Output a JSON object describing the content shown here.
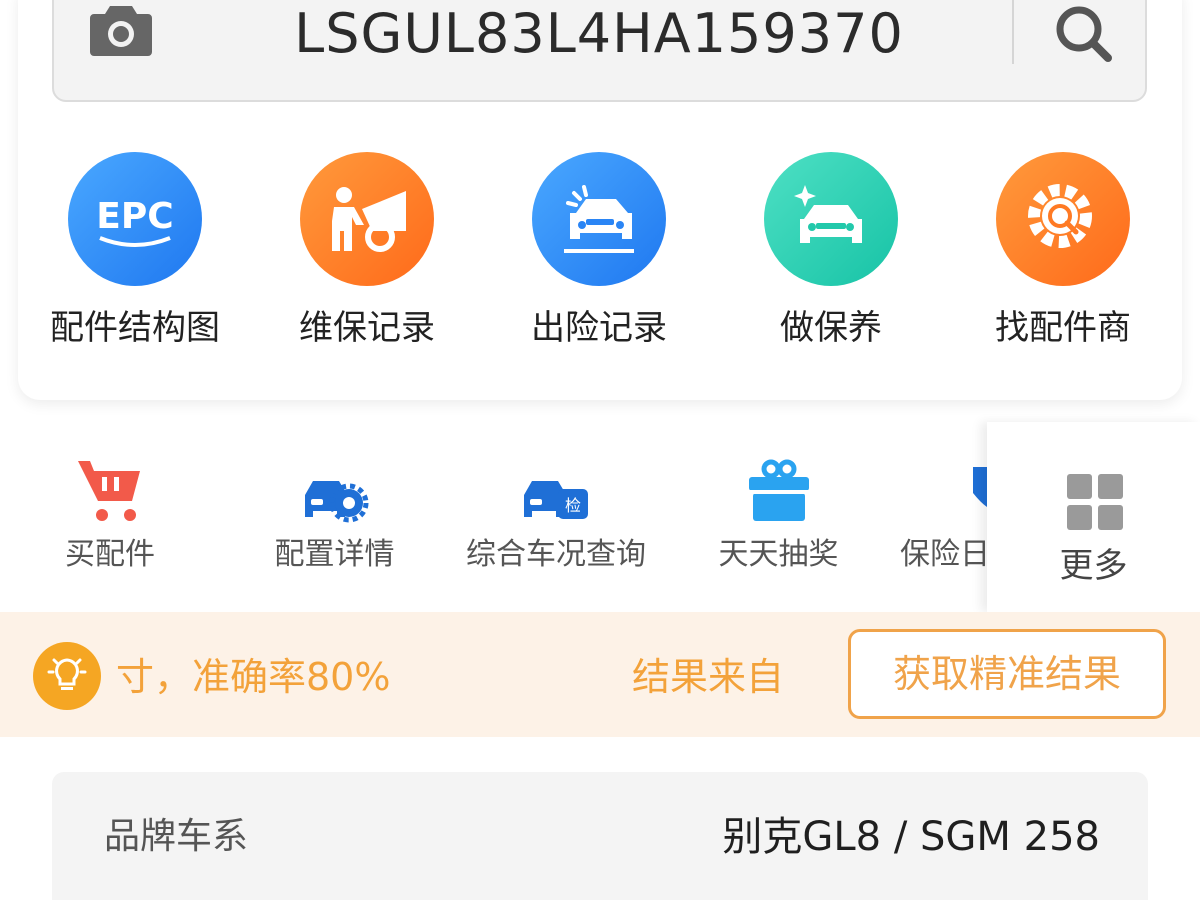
{
  "search": {
    "vin": "LSGUL83L4HA159370"
  },
  "features": [
    {
      "label": "配件结构图",
      "icon": "epc-icon",
      "badge": "EPC",
      "color_from": "#4aa8ff",
      "color_to": "#1f78f0"
    },
    {
      "label": "维保记录",
      "icon": "mechanic-icon",
      "color_from": "#ff9a3c",
      "color_to": "#ff6a1a"
    },
    {
      "label": "出险记录",
      "icon": "accident-car-icon",
      "color_from": "#4aa8ff",
      "color_to": "#1f78f0"
    },
    {
      "label": "做保养",
      "icon": "clean-car-icon",
      "color_from": "#4ee0c4",
      "color_to": "#17c3a6"
    },
    {
      "label": "找配件商",
      "icon": "gear-search-icon",
      "color_from": "#ff9a3c",
      "color_to": "#ff6a1a"
    }
  ],
  "secondary": [
    {
      "label": "买配件",
      "icon": "cart-icon"
    },
    {
      "label": "配置详情",
      "icon": "car-gear-icon"
    },
    {
      "label": "综合车况查询",
      "icon": "car-check-icon",
      "badge": "检"
    },
    {
      "label": "天天抽奖",
      "icon": "gift-icon"
    },
    {
      "label": "保险日",
      "icon": "shield-icon"
    }
  ],
  "more": {
    "label": "更多"
  },
  "notice": {
    "text_left": "寸，准确率80%",
    "text_right": "结果来自",
    "button": "获取精准结果"
  },
  "info": {
    "label": "品牌车系",
    "value": "别克GL8 / SGM 258"
  },
  "colors": {
    "accent_orange": "#f0a34a",
    "notice_bg": "#fdf2e7",
    "brand_blue": "#1f78f0"
  }
}
